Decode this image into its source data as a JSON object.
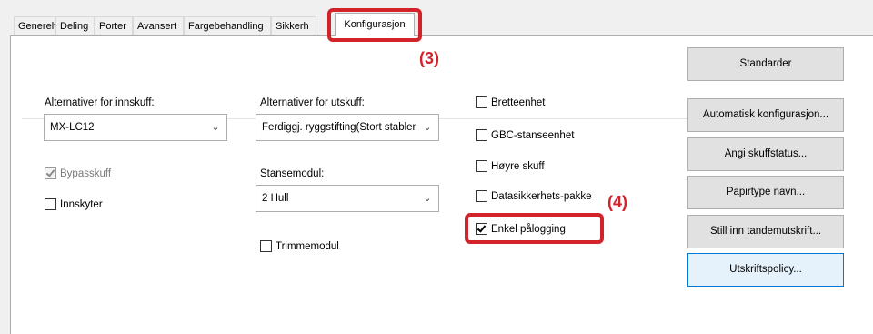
{
  "tabs": [
    {
      "label": "Generelt"
    },
    {
      "label": "Deling"
    },
    {
      "label": "Porter"
    },
    {
      "label": "Avansert"
    },
    {
      "label": "Fargebehandling"
    },
    {
      "label": "Sikkerh"
    },
    {
      "label": "Konfigurasjon",
      "active": true
    }
  ],
  "input_tray": {
    "label": "Alternativer for innskuff:",
    "value": "MX-LC12",
    "bypass_label": "Bypasskuff",
    "bypass_checked": true,
    "bypass_disabled": true,
    "inserter_label": "Innskyter",
    "inserter_checked": false
  },
  "output_tray": {
    "label": "Alternativer for utskuff:",
    "value": "Ferdiggj. ryggstifting(Stort stablema",
    "punch_label": "Stansemodul:",
    "punch_value": "2 Hull",
    "trimmer_label": "Trimmemodul",
    "trimmer_checked": false
  },
  "options": [
    {
      "label": "Bretteenhet",
      "checked": false
    },
    {
      "label": "GBC-stanseenhet",
      "checked": false
    },
    {
      "label": "Høyre skuff",
      "checked": false
    },
    {
      "label": "Datasikkerhets-pakke",
      "checked": false
    },
    {
      "label": "Enkel pålogging",
      "checked": true
    }
  ],
  "buttons": {
    "defaults": "Standarder",
    "auto_config": "Automatisk konfigurasjon...",
    "tray_status": "Angi skuffstatus...",
    "paper_type": "Papirtype navn...",
    "tandem": "Still inn tandemutskrift...",
    "print_policy": "Utskriftspolicy..."
  },
  "annotations": {
    "step3": "(3)",
    "step4": "(4)",
    "color": "#d2232a"
  },
  "icons": {
    "dropdown": "chevron-down-icon",
    "check": "checkmark-icon"
  }
}
